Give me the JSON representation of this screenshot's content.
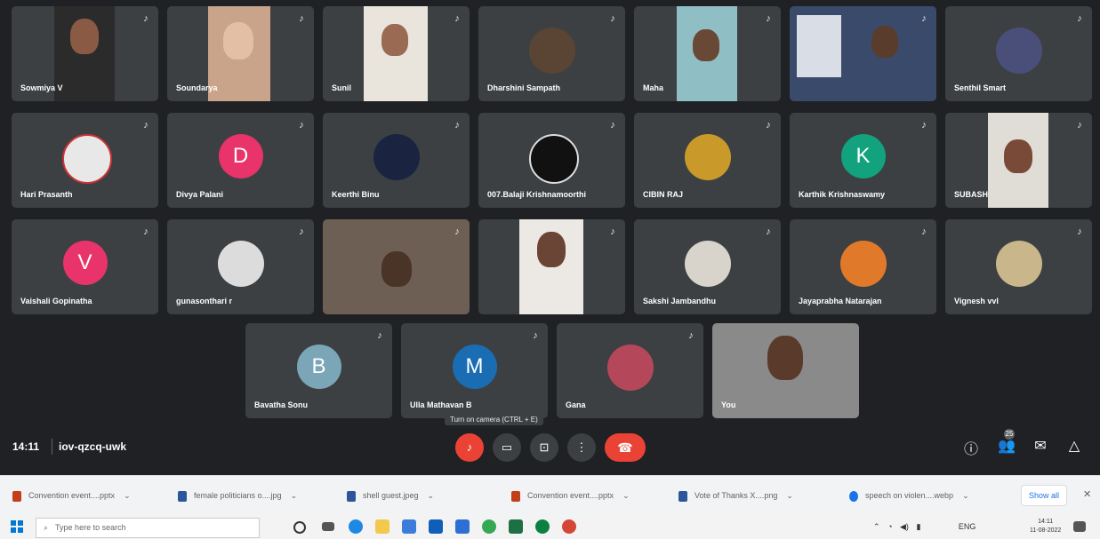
{
  "participants": [
    {
      "name": "Sowmiya V",
      "kind": "video"
    },
    {
      "name": "Soundarya",
      "kind": "video"
    },
    {
      "name": "Sunil",
      "kind": "video"
    },
    {
      "name": "Dharshini Sampath",
      "kind": "photo"
    },
    {
      "name": "Maha",
      "kind": "video"
    },
    {
      "name": "",
      "kind": "video"
    },
    {
      "name": "Senthil Smart",
      "kind": "photo"
    },
    {
      "name": "Hari Prasanth",
      "kind": "photo"
    },
    {
      "name": "Divya Palani",
      "kind": "initial",
      "initial": "D",
      "color": "#e8336b"
    },
    {
      "name": "Keerthi Binu",
      "kind": "photo"
    },
    {
      "name": "007.Balaji Krishnamoorthi",
      "kind": "photo"
    },
    {
      "name": "CIBIN RAJ",
      "kind": "photo"
    },
    {
      "name": "Karthik Krishnaswamy",
      "kind": "initial",
      "initial": "K",
      "color": "#12a27d"
    },
    {
      "name": "SUBASH",
      "kind": "video"
    },
    {
      "name": "Vaishali Gopinatha",
      "kind": "initial",
      "initial": "V",
      "color": "#e8336b"
    },
    {
      "name": "gunasonthari r",
      "kind": "photo"
    },
    {
      "name": "",
      "kind": "video"
    },
    {
      "name": "",
      "kind": "video"
    },
    {
      "name": "Sakshi Jambandhu",
      "kind": "photo"
    },
    {
      "name": "Jayaprabha Natarajan",
      "kind": "photo"
    },
    {
      "name": "Vignesh vvl",
      "kind": "photo"
    },
    {
      "name": "Bavatha Sonu",
      "kind": "initial",
      "initial": "B",
      "color": "#7aa6b8"
    },
    {
      "name": "Ulla Mathavan B",
      "kind": "initial",
      "initial": "M",
      "color": "#1b6db3"
    },
    {
      "name": "Gana",
      "kind": "photo"
    },
    {
      "name": "You",
      "kind": "video"
    }
  ],
  "meeting": {
    "time": "14:11",
    "code": "iov-qzcq-uwk",
    "tooltip": "Turn on camera (CTRL + E)"
  },
  "controls": {
    "mic_icon": "mic-off-icon",
    "camera_icon": "camera-off-icon",
    "present_icon": "present-icon",
    "more_icon": "more-vert-icon",
    "end_icon": "end-call-icon",
    "participants_count": "25"
  },
  "downloads": [
    {
      "label": "Convention event....pptx",
      "color": "#c43e1c"
    },
    {
      "label": "female politicians o....jpg",
      "color": "#2b579a"
    },
    {
      "label": "shell guest.jpeg",
      "color": "#2b579a"
    },
    {
      "label": "Convention event....pptx",
      "color": "#c43e1c"
    },
    {
      "label": "Vote of Thanks X....png",
      "color": "#2b579a"
    },
    {
      "label": "speech on violen....webp",
      "color": "#1a73e8"
    }
  ],
  "downloads_show_all": "Show all",
  "taskbar": {
    "search_placeholder": "Type here to search",
    "clock_time": "14:11",
    "clock_date": "11-08-2022",
    "lang": "ENG"
  }
}
